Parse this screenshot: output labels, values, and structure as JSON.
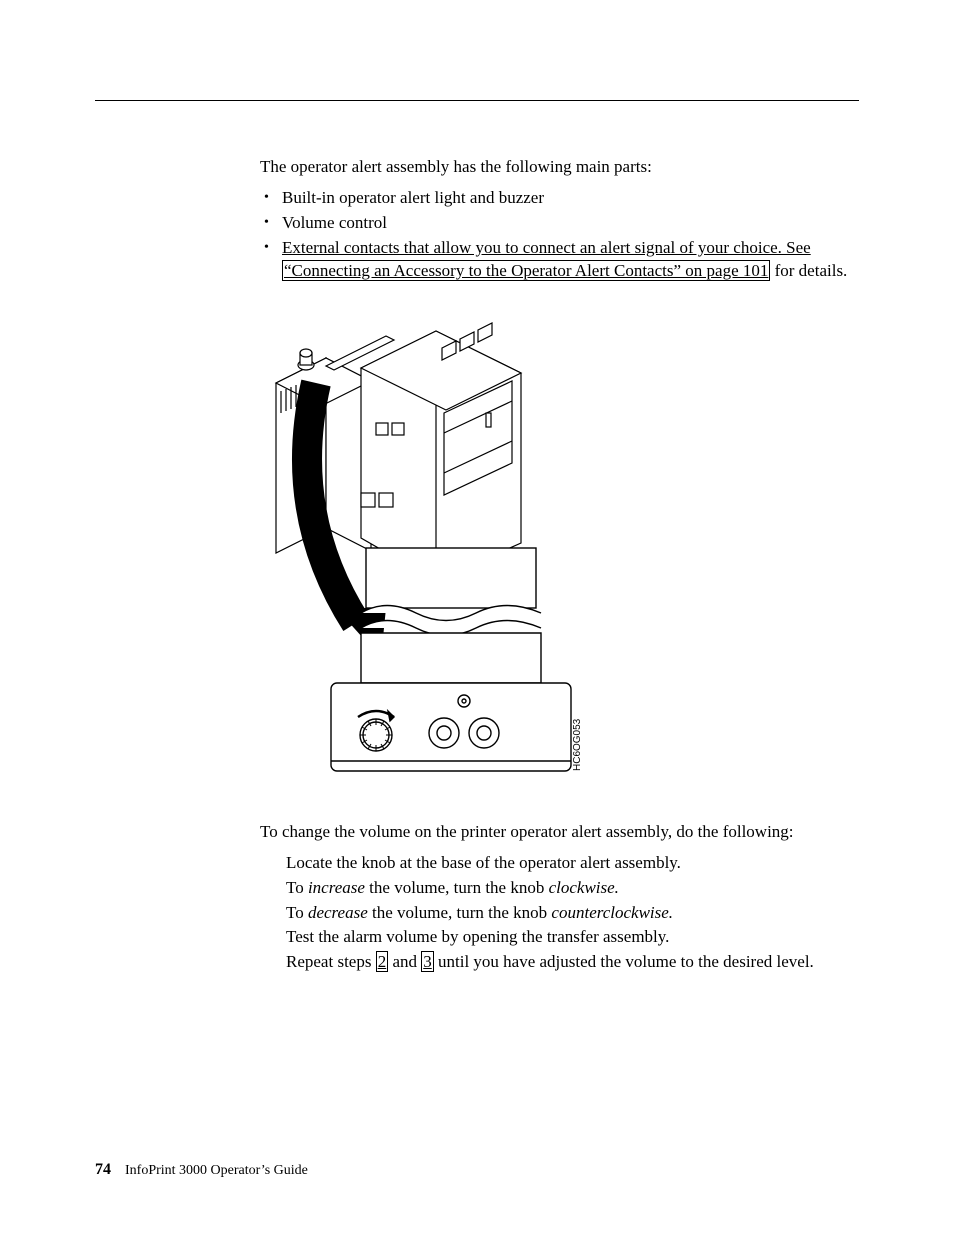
{
  "intro": "The operator alert assembly has the following main parts:",
  "bullets": {
    "b1": "Built-in operator alert light and buzzer",
    "b2": "Volume control",
    "b3_prefix": "External contacts that allow you to connect an alert signal of your choice. See ",
    "b3_link": "“Connecting an Accessory to the Operator Alert Contacts” on page 101",
    "b3_suffix": " for details."
  },
  "figure": {
    "code": "HC6OG053"
  },
  "procedure": {
    "lead": "To change the volume on the printer operator alert assembly, do the following:",
    "s1": "Locate the knob at the base of the operator alert assembly.",
    "s2_a": "To ",
    "s2_b": "increase",
    "s2_c": " the volume, turn the knob ",
    "s2_d": "clockwise.",
    "s3_a": "To ",
    "s3_b": "decrease",
    "s3_c": " the volume, turn the knob ",
    "s3_d": "counterclockwise.",
    "s4": "Test the alarm volume by opening the transfer assembly.",
    "s5_a": "Repeat steps ",
    "s5_ref1": "2",
    "s5_b": " and ",
    "s5_ref2": "3",
    "s5_c": " until you have adjusted the volume to the desired level."
  },
  "footer": {
    "page": "74",
    "title": "InfoPrint 3000 Operator’s Guide"
  }
}
